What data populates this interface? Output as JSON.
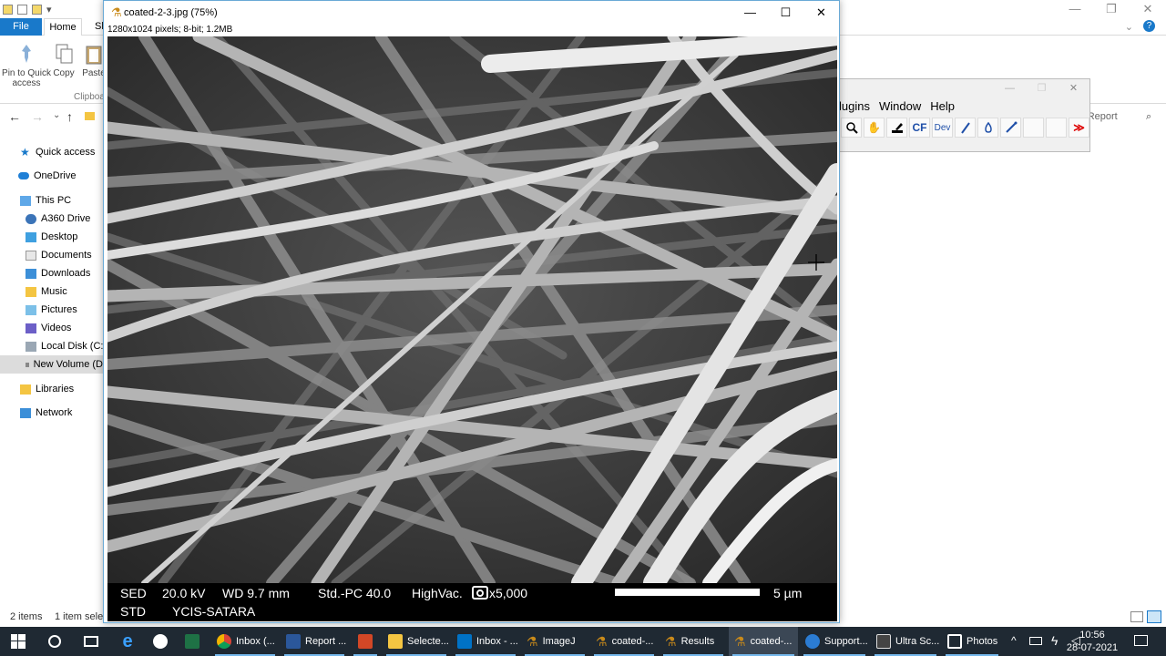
{
  "explorer": {
    "tabs": {
      "file": "File",
      "home": "Home",
      "share": "Sh"
    },
    "ribbon": {
      "pin": "Pin to Quick access",
      "copy": "Copy",
      "paste": "Paste",
      "group": "Clipboa"
    },
    "search_placeholder": "r Report",
    "nav": [
      "Quick access",
      "OneDrive",
      "This PC",
      "A360 Drive",
      "Desktop",
      "Documents",
      "Downloads",
      "Music",
      "Pictures",
      "Videos",
      "Local Disk (C:)",
      "New Volume (D",
      "Libraries",
      "Network"
    ],
    "status": {
      "items": "2 items",
      "selected": "1 item selec"
    }
  },
  "imagej": {
    "menus": [
      "lugins",
      "Window",
      "Help"
    ],
    "tools": {
      "cf": "CF",
      "dev": "Dev",
      "more": "≫"
    }
  },
  "image_window": {
    "title": "coated-2-3.jpg (75%)",
    "info": "1280x1024 pixels; 8-bit; 1.2MB",
    "databar": {
      "detector": "SED",
      "kv": "20.0 kV",
      "wd": "WD 9.7 mm",
      "std_pc": "Std.-PC 40.0",
      "vac": "HighVac.",
      "mag": "x5,000",
      "scale": "5 µm",
      "mode": "STD",
      "site": "YCIS-SATARA"
    }
  },
  "taskbar": {
    "items": [
      "Inbox (...",
      "Report ...",
      "Selecte...",
      "Inbox - ...",
      "ImageJ",
      "coated-...",
      "Results",
      "coated-...",
      "Support...",
      "Ultra Sc...",
      "Photos"
    ],
    "time": "10:56",
    "date": "28-07-2021"
  },
  "colors": {
    "accent": "#1979ca",
    "taskbar": "#1f2933",
    "excel": "#1e7145",
    "word": "#2b579a",
    "ppt": "#d24726",
    "outlook": "#0072c6"
  }
}
